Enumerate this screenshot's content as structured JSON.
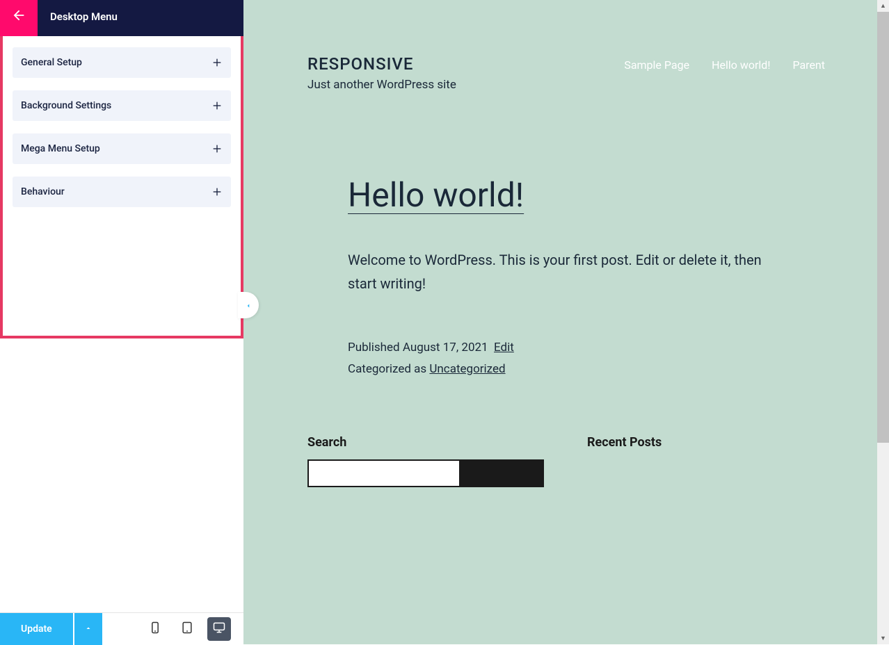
{
  "sidebar": {
    "title": "Desktop Menu",
    "accordion": [
      {
        "label": "General Setup"
      },
      {
        "label": "Background Settings"
      },
      {
        "label": "Mega Menu Setup"
      },
      {
        "label": "Behaviour"
      }
    ],
    "update_label": "Update"
  },
  "preview": {
    "site_title": "RESPONSIVE",
    "site_tagline": "Just another WordPress site",
    "nav": [
      {
        "label": "Sample Page"
      },
      {
        "label": "Hello world!"
      },
      {
        "label": "Parent"
      }
    ],
    "post": {
      "title": "Hello world!",
      "body": "Welcome to WordPress. This is your first post. Edit or delete it, then start writing!",
      "published_prefix": "Published ",
      "published_date": "August 17, 2021",
      "edit_label": "Edit",
      "categorized_prefix": "Categorized as ",
      "category": "Uncategorized"
    },
    "widgets": {
      "search_title": "Search",
      "recent_title": "Recent Posts"
    }
  }
}
